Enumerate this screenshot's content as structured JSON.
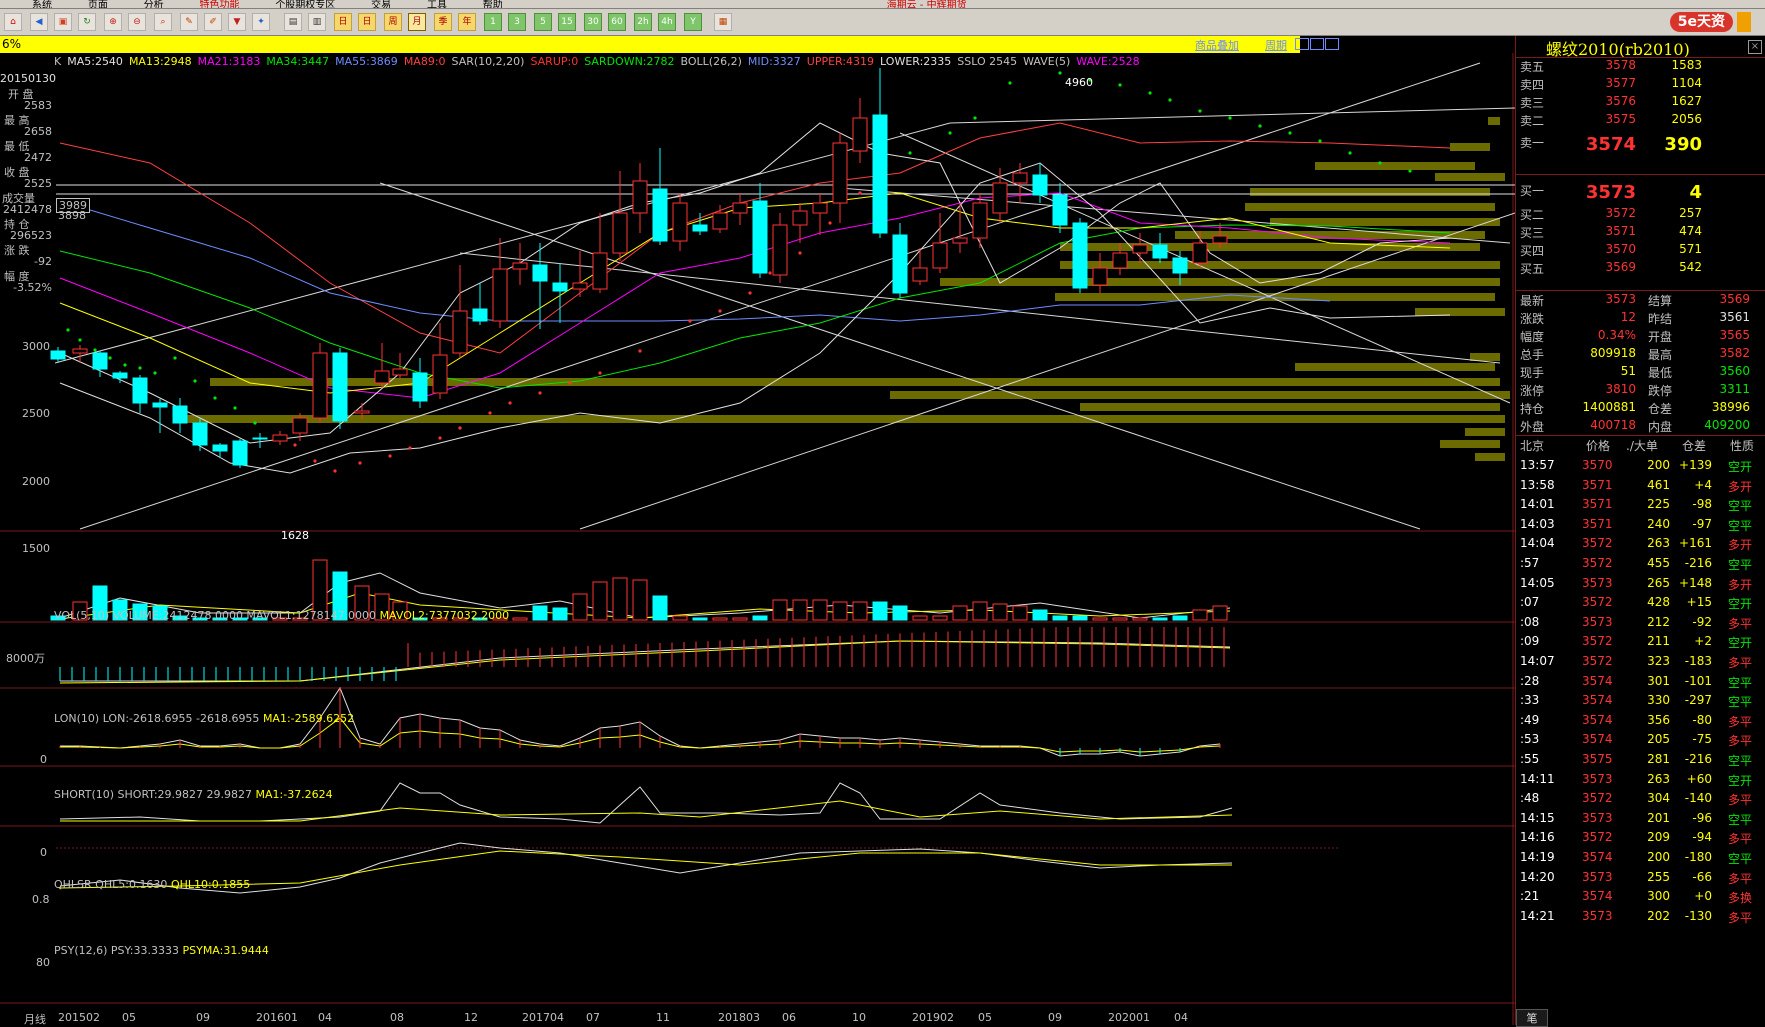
{
  "menu": {
    "items": [
      "系统",
      "页面",
      "分析",
      "特色功能",
      "个股期权专区",
      "交易",
      "工具",
      "帮助"
    ],
    "title": "海期云 - 中辉期货"
  },
  "toolbar": {
    "periods": [
      "分时",
      "K线",
      "日",
      "周",
      "月",
      "季",
      "年",
      "1",
      "3",
      "5",
      "15",
      "30",
      "60",
      "2m",
      "4m",
      "Y"
    ]
  },
  "topbar": {
    "left_text": "6%",
    "tabs": [
      "商品叠加",
      "周期"
    ]
  },
  "chart": {
    "indicator_line": [
      {
        "t": "K",
        "c": "#c0c0c0"
      },
      {
        "t": "MA5:2540",
        "c": "#e0e0e0"
      },
      {
        "t": "MA13:2948",
        "c": "#ffff00"
      },
      {
        "t": "MA21:3183",
        "c": "#ff00ff"
      },
      {
        "t": "MA34:3447",
        "c": "#00e600"
      },
      {
        "t": "MA55:3869",
        "c": "#6e8cff"
      },
      {
        "t": "MA89:0",
        "c": "#ff4040"
      },
      {
        "t": "SAR(10,2,20)",
        "c": "#c0c0c0"
      },
      {
        "t": "SARUP:0",
        "c": "#ff3232"
      },
      {
        "t": "SARDOWN:2782",
        "c": "#00e600"
      },
      {
        "t": "BOLL(26,2)",
        "c": "#c0c0c0"
      },
      {
        "t": "MID:3327",
        "c": "#6e8cff"
      },
      {
        "t": "UPPER:4319",
        "c": "#ff4040"
      },
      {
        "t": "LOWER:2335",
        "c": "#e0e0e0"
      },
      {
        "t": "SSLO 2545",
        "c": "#c0c0c0"
      },
      {
        "t": "WAVE(5)",
        "c": "#c0c0c0"
      },
      {
        "t": "WAVE:2528",
        "c": "#ff00ff"
      }
    ],
    "price_axis": [
      "3000",
      "2500",
      "2000",
      "1500"
    ],
    "price_labels": {
      "high": "4960",
      "low": "1628",
      "box1": "3989",
      "box2": "3898"
    },
    "info_box": {
      "date": "20150130",
      "open_l": "开  盘",
      "open": "2583",
      "high_l": "最  高",
      "high": "2658",
      "low_l": "最  低",
      "low": "2472",
      "close_l": "收  盘",
      "close": "2525",
      "vol_l": "成交量",
      "vol": "2412478",
      "oi_l": "持  仓",
      "oi": "296523",
      "chg_l": "涨  跌",
      "chg": "-92",
      "pct_l": "幅  度",
      "pct": "-3.52%"
    },
    "vol": {
      "header": "VOL(5,10)  VOLUME:2412478.0000  MAVOL1:1278147.0000",
      "mavol2": "MAVOL2:7377032.2000",
      "axis": "8000万"
    },
    "lon": {
      "header": "LON(10)  LON:-2618.6955  -2618.6955",
      "ma": "MA1:-2589.6252",
      "axis": "0"
    },
    "short": {
      "header": "SHORT(10)  SHORT:29.9827  29.9827",
      "ma": "MA1:-37.2624",
      "axis": "0"
    },
    "qhlsr": {
      "header": "QHLSR  QHL5:0.1630",
      "ma": "QHL10:0.1855",
      "axis": "0.8"
    },
    "psy": {
      "header": "PSY(12,6)  PSY:33.3333",
      "ma": "PSYMA:31.9444",
      "axis": "80"
    },
    "x_axis": {
      "corner": "月线",
      "labels": [
        "201502",
        "05",
        "09",
        "201601",
        "04",
        "08",
        "12",
        "201704",
        "07",
        "11",
        "201803",
        "06",
        "10",
        "201902",
        "05",
        "09",
        "202001",
        "04"
      ]
    }
  },
  "quote": {
    "title": "螺纹2010(rb2010)",
    "asks": [
      {
        "l": "卖五",
        "p": "3578",
        "v": "1583"
      },
      {
        "l": "卖四",
        "p": "3577",
        "v": "1104"
      },
      {
        "l": "卖三",
        "p": "3576",
        "v": "1627"
      },
      {
        "l": "卖二",
        "p": "3575",
        "v": "2056"
      },
      {
        "l": "卖一",
        "p": "3574",
        "v": "390"
      }
    ],
    "bids": [
      {
        "l": "买一",
        "p": "3573",
        "v": "4"
      },
      {
        "l": "买二",
        "p": "3572",
        "v": "257"
      },
      {
        "l": "买三",
        "p": "3571",
        "v": "474"
      },
      {
        "l": "买四",
        "p": "3570",
        "v": "571"
      },
      {
        "l": "买五",
        "p": "3569",
        "v": "542"
      }
    ],
    "stats": [
      {
        "l": "最新",
        "v": "3573",
        "vc": "red",
        "l2": "结算",
        "v2": "3569",
        "v2c": "red"
      },
      {
        "l": "涨跌",
        "v": "12",
        "vc": "red",
        "l2": "昨结",
        "v2": "3561",
        "v2c": "wht"
      },
      {
        "l": "幅度",
        "v": "0.34%",
        "vc": "red",
        "l2": "开盘",
        "v2": "3565",
        "v2c": "red"
      },
      {
        "l": "总手",
        "v": "809918",
        "vc": "yel",
        "l2": "最高",
        "v2": "3582",
        "v2c": "red"
      },
      {
        "l": "现手",
        "v": "51",
        "vc": "yel",
        "l2": "最低",
        "v2": "3560",
        "v2c": "grn"
      },
      {
        "l": "涨停",
        "v": "3810",
        "vc": "red",
        "l2": "跌停",
        "v2": "3311",
        "v2c": "grn"
      },
      {
        "l": "持仓",
        "v": "1400881",
        "vc": "yel",
        "l2": "仓差",
        "v2": "38996",
        "v2c": "yel"
      },
      {
        "l": "外盘",
        "v": "400718",
        "vc": "red",
        "l2": "内盘",
        "v2": "409200",
        "v2c": "grn"
      }
    ],
    "tick_header": [
      "北京",
      "价格",
      "./大单",
      "仓差",
      "性质"
    ],
    "ticks": [
      {
        "t": "13:57",
        "p": "3570",
        "v": "200",
        "d": "+139",
        "n": "空开",
        "nc": "grn"
      },
      {
        "t": "13:58",
        "p": "3571",
        "v": "461",
        "d": "+4",
        "n": "多开",
        "nc": "red"
      },
      {
        "t": "14:01",
        "p": "3571",
        "v": "225",
        "d": "-98",
        "n": "空平",
        "nc": "grn"
      },
      {
        "t": "14:03",
        "p": "3571",
        "v": "240",
        "d": "-97",
        "n": "空平",
        "nc": "grn"
      },
      {
        "t": "14:04",
        "p": "3572",
        "v": "263",
        "d": "+161",
        "n": "多开",
        "nc": "red"
      },
      {
        "t": ":57",
        "p": "3572",
        "v": "455",
        "d": "-216",
        "n": "空平",
        "nc": "grn"
      },
      {
        "t": "14:05",
        "p": "3573",
        "v": "265",
        "d": "+148",
        "n": "多开",
        "nc": "red"
      },
      {
        "t": ":07",
        "p": "3572",
        "v": "428",
        "d": "+15",
        "n": "空开",
        "nc": "grn"
      },
      {
        "t": ":08",
        "p": "3573",
        "v": "212",
        "d": "-92",
        "n": "多平",
        "nc": "red"
      },
      {
        "t": ":09",
        "p": "3572",
        "v": "211",
        "d": "+2",
        "n": "空开",
        "nc": "grn"
      },
      {
        "t": "14:07",
        "p": "3572",
        "v": "323",
        "d": "-183",
        "n": "多平",
        "nc": "red"
      },
      {
        "t": ":28",
        "p": "3574",
        "v": "301",
        "d": "-101",
        "n": "空平",
        "nc": "grn"
      },
      {
        "t": ":33",
        "p": "3574",
        "v": "330",
        "d": "-297",
        "n": "空平",
        "nc": "grn"
      },
      {
        "t": ":49",
        "p": "3574",
        "v": "356",
        "d": "-80",
        "n": "多平",
        "nc": "red"
      },
      {
        "t": ":53",
        "p": "3574",
        "v": "205",
        "d": "-75",
        "n": "多平",
        "nc": "red"
      },
      {
        "t": ":55",
        "p": "3575",
        "v": "281",
        "d": "-216",
        "n": "空平",
        "nc": "grn"
      },
      {
        "t": "14:11",
        "p": "3573",
        "v": "263",
        "d": "+60",
        "n": "空开",
        "nc": "grn"
      },
      {
        "t": ":48",
        "p": "3572",
        "v": "304",
        "d": "-140",
        "n": "多平",
        "nc": "red"
      },
      {
        "t": "14:15",
        "p": "3573",
        "v": "201",
        "d": "-96",
        "n": "空平",
        "nc": "grn"
      },
      {
        "t": "14:16",
        "p": "3572",
        "v": "209",
        "d": "-94",
        "n": "多平",
        "nc": "red"
      },
      {
        "t": "14:19",
        "p": "3574",
        "v": "200",
        "d": "-180",
        "n": "空平",
        "nc": "grn"
      },
      {
        "t": "14:20",
        "p": "3573",
        "v": "255",
        "d": "-66",
        "n": "多平",
        "nc": "red"
      },
      {
        "t": ":21",
        "p": "3574",
        "v": "300",
        "d": "+0",
        "n": "多换",
        "nc": "red"
      },
      {
        "t": "14:21",
        "p": "3573",
        "v": "202",
        "d": "-130",
        "n": "多平",
        "nc": "red"
      }
    ],
    "bottom_tab": "笔"
  },
  "colors": {
    "up": "#ff3232",
    "down": "#00ffff",
    "grid": "#7a1a1a",
    "accent": "#ffff00"
  }
}
